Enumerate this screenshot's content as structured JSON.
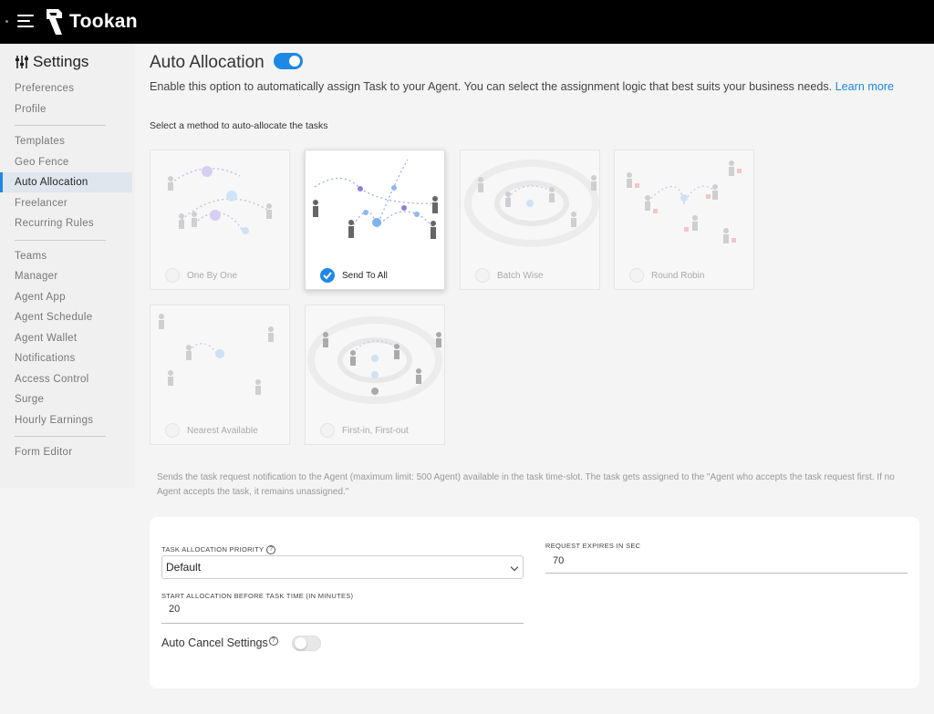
{
  "header": {
    "brand": "Tookan"
  },
  "sidebar": {
    "title": "Settings",
    "groups": [
      [
        "Preferences",
        "Profile"
      ],
      [
        "Templates",
        "Geo Fence",
        "Auto Allocation",
        "Freelancer",
        "Recurring Rules"
      ],
      [
        "Teams",
        "Manager",
        "Agent App",
        "Agent Schedule",
        "Agent Wallet",
        "Notifications",
        "Access Control",
        "Surge",
        "Hourly Earnings"
      ],
      [
        "Form Editor"
      ]
    ],
    "active": "Auto Allocation"
  },
  "main": {
    "title": "Auto Allocation",
    "enabled": true,
    "description": "Enable this option to automatically assign Task to your Agent. You can select the assignment logic that best suits your business needs.",
    "learn_more": "Learn more",
    "select_label": "Select a method to auto-allocate the tasks",
    "methods": [
      "One By One",
      "Send To All",
      "Batch Wise",
      "Round Robin",
      "Nearest Available",
      "First-in, First-out"
    ],
    "selected_method": "Send To All",
    "explanation": "Sends the task request notification to the Agent (maximum limit: 500 Agent) available in the task time-slot. The task gets assigned to the \"Agent who accepts the task request first. If no Agent accepts the task, it remains unassigned.\""
  },
  "settings_panel": {
    "priority_label": "TASK ALLOCATION PRIORITY",
    "priority_value": "Default",
    "expires_label": "REQUEST EXPIRES IN SEC",
    "expires_value": "70",
    "start_label": "START ALLOCATION BEFORE TASK TIME (IN MINUTES)",
    "start_value": "20",
    "auto_cancel_label": "Auto Cancel Settings",
    "auto_cancel_enabled": false
  },
  "colors": {
    "accent": "#1e88e5",
    "topbar": "#000000"
  }
}
